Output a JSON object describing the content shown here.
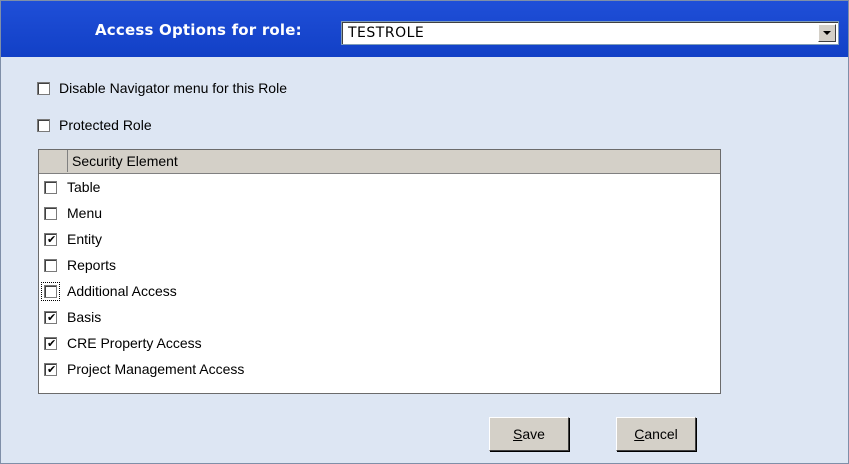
{
  "header": {
    "label": "Access Options for role:",
    "role_value": "TESTROLE"
  },
  "options": [
    {
      "label": "Disable Navigator menu for this Role",
      "checked": false
    },
    {
      "label": "Protected Role",
      "checked": false
    }
  ],
  "grid": {
    "column_header": "Security Element",
    "rows": [
      {
        "label": "Table",
        "checked": false
      },
      {
        "label": "Menu",
        "checked": false
      },
      {
        "label": "Entity",
        "checked": true
      },
      {
        "label": "Reports",
        "checked": false
      },
      {
        "label": "Additional Access",
        "checked": false,
        "focused": true
      },
      {
        "label": "Basis",
        "checked": true
      },
      {
        "label": "CRE Property Access",
        "checked": true
      },
      {
        "label": "Project Management Access",
        "checked": true
      }
    ]
  },
  "buttons": {
    "save": {
      "mnemonic": "S",
      "rest": "ave"
    },
    "cancel": {
      "mnemonic": "C",
      "rest": "ancel"
    }
  },
  "colors": {
    "header_bg": "#1f4fd8",
    "panel_bg": "#dde6f3",
    "button_face": "#d4d0c8"
  }
}
